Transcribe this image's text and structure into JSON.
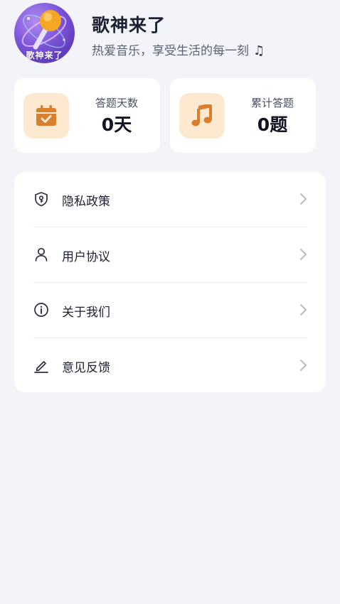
{
  "profile": {
    "app_name": "歌神来了",
    "tagline": "热爱音乐，享受生活的每一刻",
    "tagline_emoji": "♫",
    "avatar_caption": "歌神来了"
  },
  "stats": {
    "days": {
      "label": "答题天数",
      "value": "0天",
      "icon": "calendar-check-icon"
    },
    "total": {
      "label": "累计答题",
      "value": "0题",
      "icon": "music-note-icon"
    }
  },
  "menu": {
    "items": [
      {
        "label": "隐私政策",
        "icon": "shield-icon"
      },
      {
        "label": "用户协议",
        "icon": "user-icon"
      },
      {
        "label": "关于我们",
        "icon": "info-icon"
      },
      {
        "label": "意见反馈",
        "icon": "pen-icon"
      }
    ]
  },
  "colors": {
    "background": "#f3f4fa",
    "card": "#ffffff",
    "icon_bg": "#fde9cf",
    "accent_orange": "#d9802f"
  }
}
